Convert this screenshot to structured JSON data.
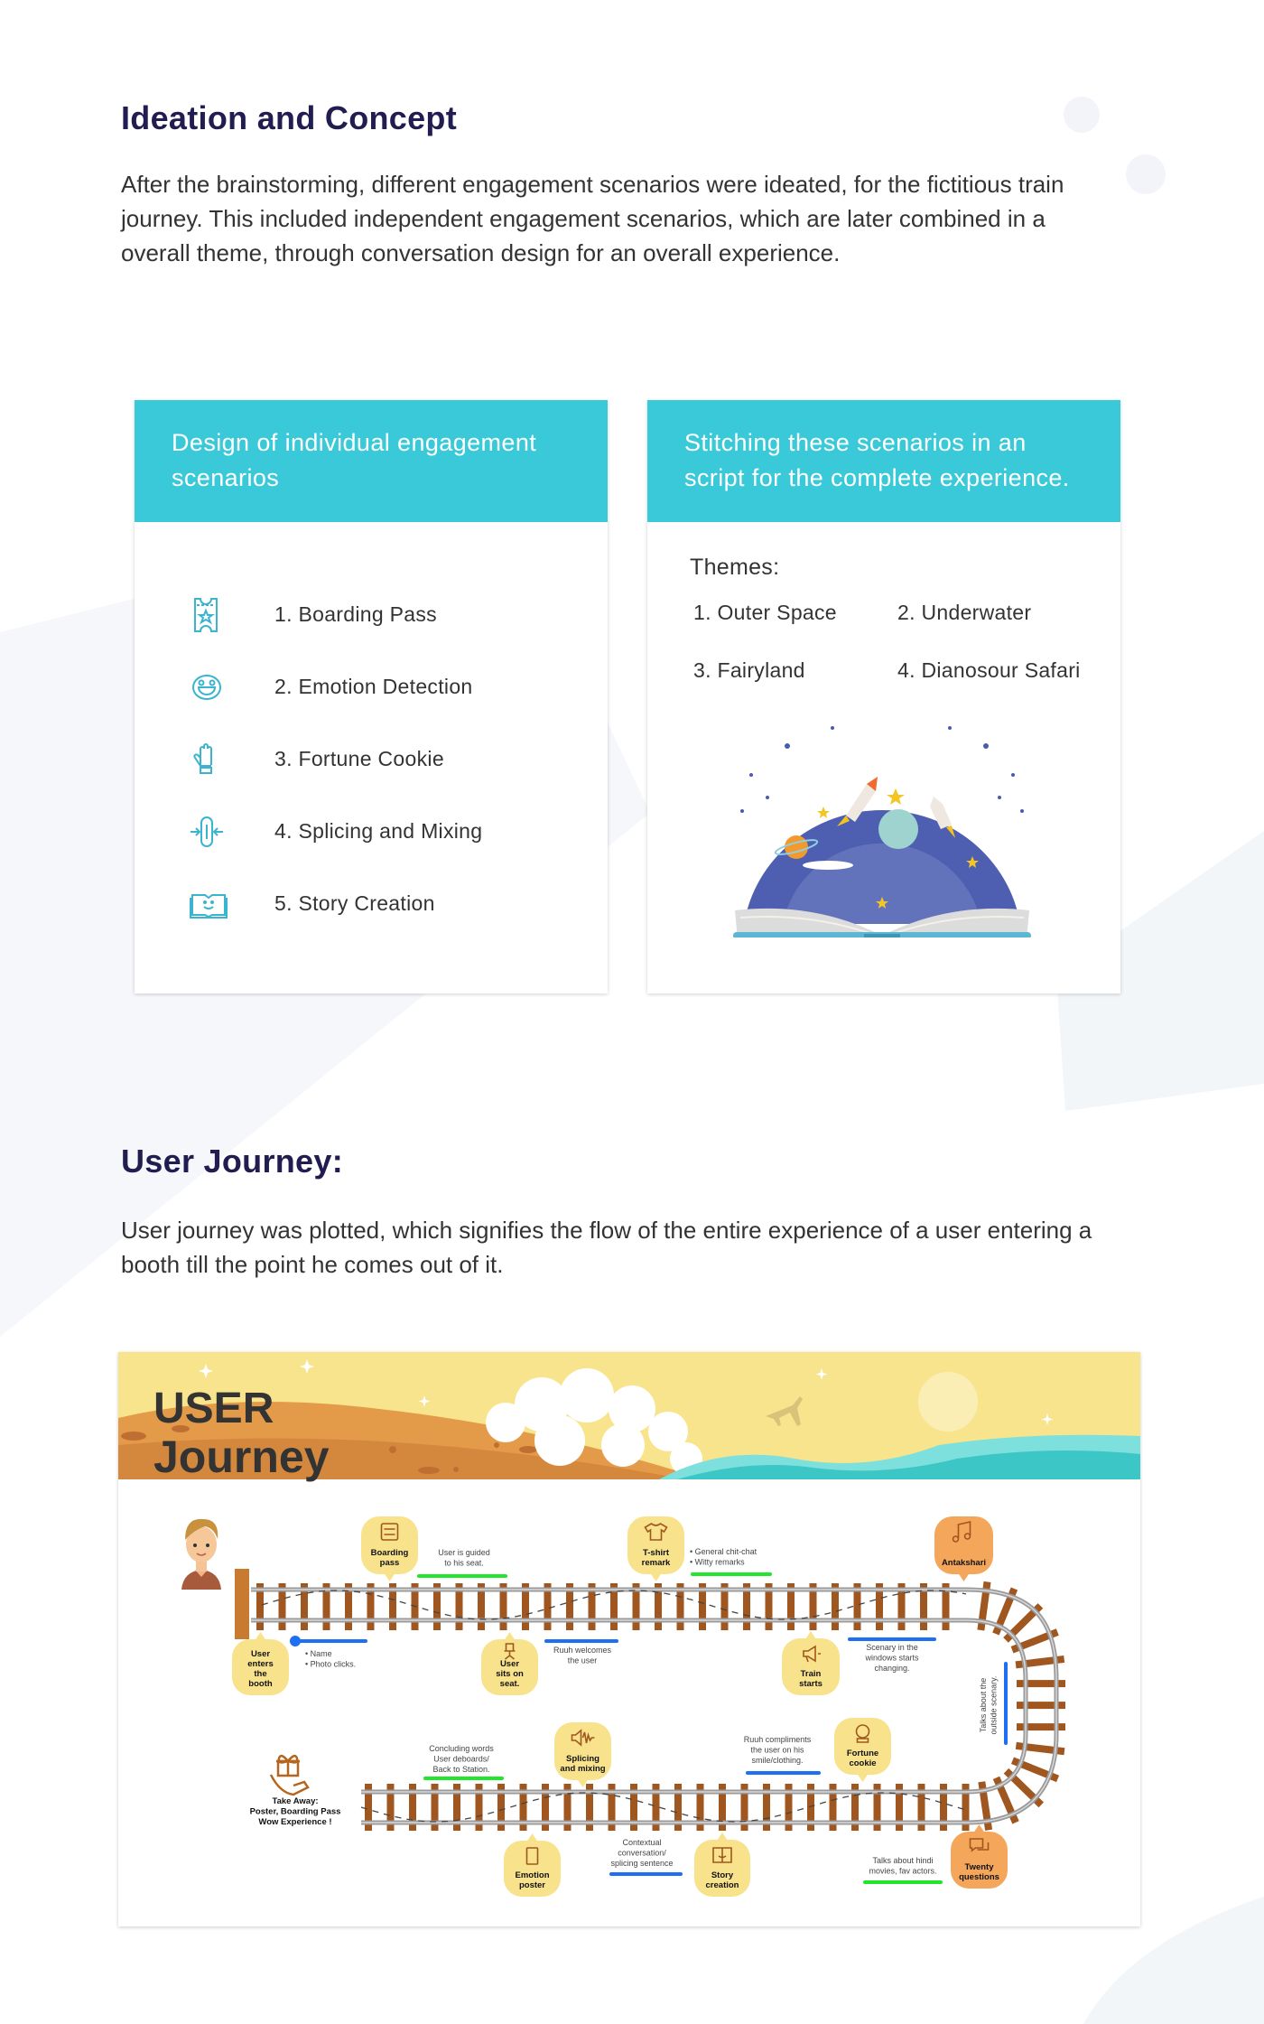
{
  "ideation": {
    "title": "Ideation and Concept",
    "paragraph": "After the brainstorming, different engagement scenarios were ideated, for the fictitious train journey. This included independent engagement scenarios, which are later combined in a overall theme, through conversation design for an overall experience."
  },
  "card_left": {
    "header": "Design of individual engagement scenarios",
    "items": [
      {
        "label": "1. Boarding Pass",
        "icon": "ticket-icon"
      },
      {
        "label": "2. Emotion Detection",
        "icon": "smiley-icon"
      },
      {
        "label": "3. Fortune Cookie",
        "icon": "hand-icon"
      },
      {
        "label": "4. Splicing and Mixing",
        "icon": "splice-icon"
      },
      {
        "label": "5. Story Creation",
        "icon": "book-icon"
      }
    ]
  },
  "card_right": {
    "header": "Stitching these scenarios in an script for the complete experience.",
    "themes_label": "Themes:",
    "themes": [
      "1. Outer Space",
      "2. Underwater",
      "3. Fairyland",
      "4. Dianosour Safari"
    ]
  },
  "user_journey": {
    "title": "User Journey:",
    "paragraph": "User journey was plotted, which signifies the flow of the entire experience of a user entering a booth till the point he comes out of it."
  },
  "journey_map": {
    "title_line1": "USER",
    "title_line2": "Journey",
    "colors": {
      "bubble": "#f8e38c",
      "bubble_alt": "#f4a65a",
      "green": "#22e62e",
      "blue": "#1f6ff2",
      "tie": "#a0561f",
      "accent": "#3ac9d8"
    },
    "bubbles": [
      {
        "lines": [
          "Boarding",
          "pass"
        ],
        "icon": "boarding-pass-icon"
      },
      {
        "lines": [
          "T-shirt",
          "remark"
        ],
        "icon": "tshirt-icon"
      },
      {
        "lines": [
          "Antakshari"
        ],
        "icon": "music-note-icon"
      },
      {
        "lines": [
          "User",
          "enters",
          "the",
          "booth"
        ],
        "icon": ""
      },
      {
        "lines": [
          "User",
          "sits on",
          "seat."
        ],
        "icon": "chair-icon"
      },
      {
        "lines": [
          "Train",
          "starts"
        ],
        "icon": "megaphone-icon"
      },
      {
        "lines": [
          "Splicing",
          "and mixing"
        ],
        "icon": "sound-wave-icon"
      },
      {
        "lines": [
          "Fortune",
          "cookie"
        ],
        "icon": "crystal-ball-icon"
      },
      {
        "lines": [
          "Emotion",
          "poster"
        ],
        "icon": "poster-icon"
      },
      {
        "lines": [
          "Story",
          "creation"
        ],
        "icon": "story-book-icon"
      },
      {
        "lines": [
          "Twenty",
          "questions"
        ],
        "icon": "chat-icon"
      }
    ],
    "notes": [
      {
        "lines": [
          "User is guided",
          "to his seat."
        ]
      },
      {
        "lines": [
          "• General chit-chat",
          "• Witty remarks"
        ]
      },
      {
        "lines": [
          "• Name",
          "• Photo clicks."
        ]
      },
      {
        "lines": [
          "Ruuh welcomes",
          "the user"
        ]
      },
      {
        "lines": [
          "Scenary in the",
          "windows starts",
          "changing."
        ]
      },
      {
        "lines": [
          "Talks about the",
          "outside scenary."
        ]
      },
      {
        "lines": [
          "Concluding words",
          "User deboards/",
          "Back to Station."
        ]
      },
      {
        "lines": [
          "Contextual",
          "conversation/",
          "splicing sentence"
        ]
      },
      {
        "lines": [
          "Ruuh compliments",
          "the user on his",
          "smile/clothing."
        ]
      },
      {
        "lines": [
          "Talks about hindi",
          "movies, fav actors."
        ]
      },
      {
        "lines": [
          "Take Away:",
          "Poster, Boarding Pass",
          "Wow Experience !"
        ]
      }
    ]
  }
}
